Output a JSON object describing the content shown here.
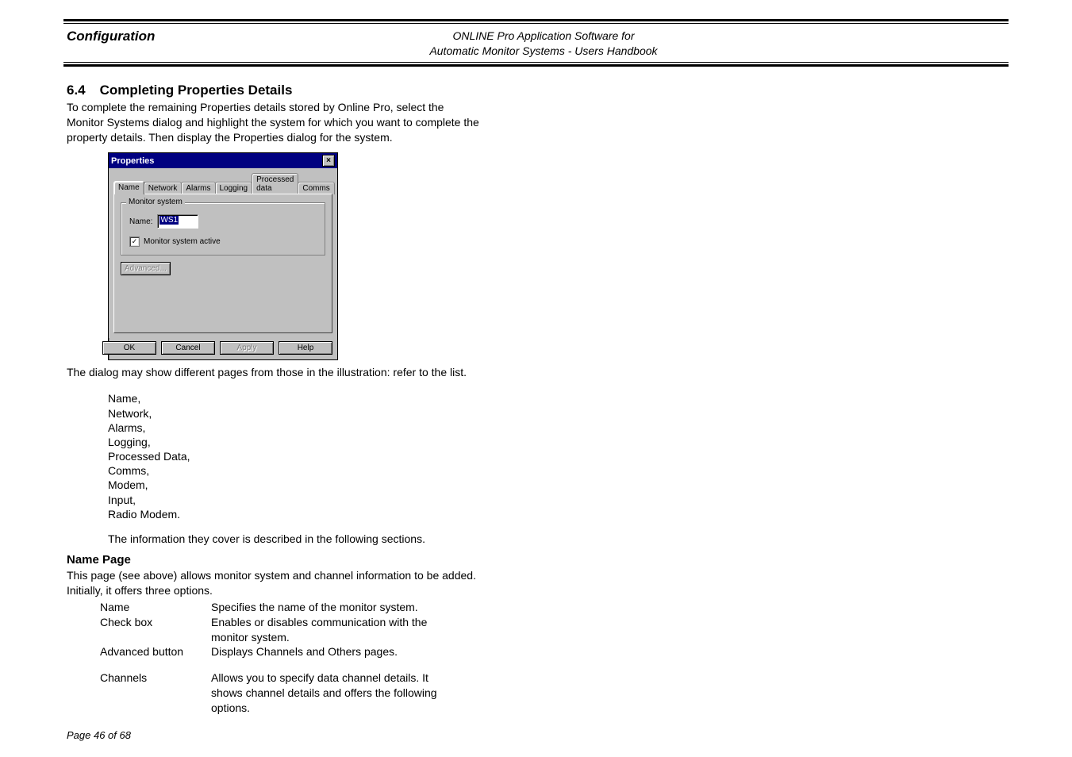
{
  "header": {
    "left": "Configuration",
    "right_l1": "ONLINE Pro Application Software for",
    "right_l2": "Automatic Monitor Systems - Users Handbook"
  },
  "section": {
    "num": "6.4",
    "title": "Completing Properties Details",
    "intro": "To complete the remaining Properties details stored by Online Pro, select the Monitor Systems dialog and highlight the system for which you want to complete the property details. Then display the Properties dialog for the system."
  },
  "dialog": {
    "title": "Properties",
    "close_glyph": "×",
    "tabs": [
      "Name",
      "Network",
      "Alarms",
      "Logging",
      "Processed data",
      "Comms"
    ],
    "fieldset_legend": "Monitor system",
    "name_label": "Name:",
    "name_value": "WS1",
    "check_label": "Monitor system active",
    "check_mark": "✓",
    "advanced_btn": "Advanced...",
    "ok": "OK",
    "cancel": "Cancel",
    "apply": "Apply",
    "help": "Help"
  },
  "after_dialog": "The dialog may show different pages from those in the illustration: refer to the list.",
  "page_list": [
    "Name,",
    "Network,",
    "Alarms,",
    "Logging,",
    "Processed Data,",
    "Comms,",
    "Modem,",
    "Input,",
    "Radio Modem."
  ],
  "page_list_after": "The information they cover is described in the following sections.",
  "name_page": {
    "heading": "Name Page",
    "intro": "This page (see above) allows monitor system and channel information to be added. Initially, it offers three options.",
    "rows": [
      {
        "term": "Name",
        "desc": "Specifies the name of the monitor system."
      },
      {
        "term": "Check box",
        "desc": "Enables or disables communication with the monitor system."
      },
      {
        "term": "Advanced button",
        "desc": "Displays Channels and Others pages."
      }
    ],
    "rows2": [
      {
        "term": "Channels",
        "desc": "Allows you to specify data channel details. It shows channel details and offers the following options."
      }
    ]
  },
  "footer": "Page 46 of 68"
}
